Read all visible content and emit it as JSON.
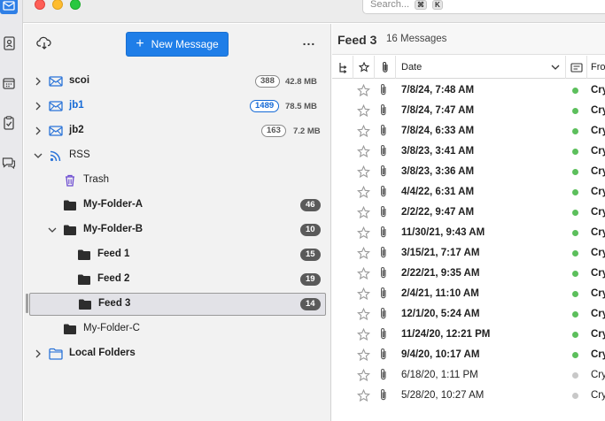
{
  "search": {
    "placeholder": "Search...",
    "shortcut_keys": [
      "⌘",
      "K"
    ]
  },
  "spaces": [
    {
      "icon": "mail-icon",
      "active": true
    },
    {
      "icon": "address-book-icon"
    },
    {
      "icon": "calendar-icon"
    },
    {
      "icon": "tasks-icon"
    },
    {
      "icon": "chat-icon"
    }
  ],
  "folder_pane": {
    "new_message_label": "New Message",
    "more_label": "...",
    "folders": [
      {
        "name": "scoi",
        "count": "388",
        "size": "42.8 MB",
        "style": "account",
        "blue": false
      },
      {
        "name": "jb1",
        "count": "1489",
        "size": "78.5 MB",
        "style": "account",
        "blue": true
      },
      {
        "name": "jb2",
        "count": "163",
        "size": "7.2 MB",
        "style": "account",
        "blue": false
      },
      {
        "name": "RSS",
        "count": "",
        "size": "",
        "style": "rss"
      },
      {
        "name": "Trash",
        "count": "",
        "size": "",
        "style": "trash"
      },
      {
        "name": "My-Folder-A",
        "count": "46",
        "size": "",
        "style": "folder"
      },
      {
        "name": "My-Folder-B",
        "count": "10",
        "size": "",
        "style": "folder"
      },
      {
        "name": "Feed 1",
        "count": "15",
        "size": "",
        "style": "folder"
      },
      {
        "name": "Feed 2",
        "count": "19",
        "size": "",
        "style": "folder"
      },
      {
        "name": "Feed 3",
        "count": "14",
        "size": "",
        "style": "folder",
        "selected": true
      },
      {
        "name": "My-Folder-C",
        "count": "",
        "size": "",
        "style": "folder-plain"
      },
      {
        "name": "Local Folders",
        "count": "",
        "size": "",
        "style": "local"
      }
    ]
  },
  "thread_pane": {
    "folder_title": "Feed 3",
    "message_count": "16 Messages",
    "columns": {
      "date": "Date",
      "from": "Fro"
    },
    "messages": [
      {
        "date": "7/8/24, 7:48 AM",
        "from": "Cry",
        "unread": true
      },
      {
        "date": "7/8/24, 7:47 AM",
        "from": "Cry",
        "unread": true
      },
      {
        "date": "7/8/24, 6:33 AM",
        "from": "Cry",
        "unread": true
      },
      {
        "date": "3/8/23, 3:41 AM",
        "from": "Cry",
        "unread": true
      },
      {
        "date": "3/8/23, 3:36 AM",
        "from": "Cry",
        "unread": true
      },
      {
        "date": "4/4/22, 6:31 AM",
        "from": "Cry",
        "unread": true
      },
      {
        "date": "2/2/22, 9:47 AM",
        "from": "Cry",
        "unread": true
      },
      {
        "date": "11/30/21, 9:43 AM",
        "from": "Cry",
        "unread": true
      },
      {
        "date": "3/15/21, 7:17 AM",
        "from": "Cry",
        "unread": true
      },
      {
        "date": "2/22/21, 9:35 AM",
        "from": "Cry",
        "unread": true
      },
      {
        "date": "2/4/21, 11:10 AM",
        "from": "Cry",
        "unread": true
      },
      {
        "date": "12/1/20, 5:24 AM",
        "from": "Cry",
        "unread": true
      },
      {
        "date": "11/24/20, 12:21 PM",
        "from": "Cry",
        "unread": true
      },
      {
        "date": "9/4/20, 10:17 AM",
        "from": "Cry",
        "unread": true
      },
      {
        "date": "6/18/20, 1:11 PM",
        "from": "Cry",
        "unread": false
      },
      {
        "date": "5/28/20, 10:27 AM",
        "from": "Cry",
        "unread": false
      }
    ]
  },
  "colors": {
    "accent": "#1f7ee8",
    "unread_dot": "#5cbf5c",
    "read_dot": "#c8c8c8",
    "blue_text": "#1469d6"
  }
}
